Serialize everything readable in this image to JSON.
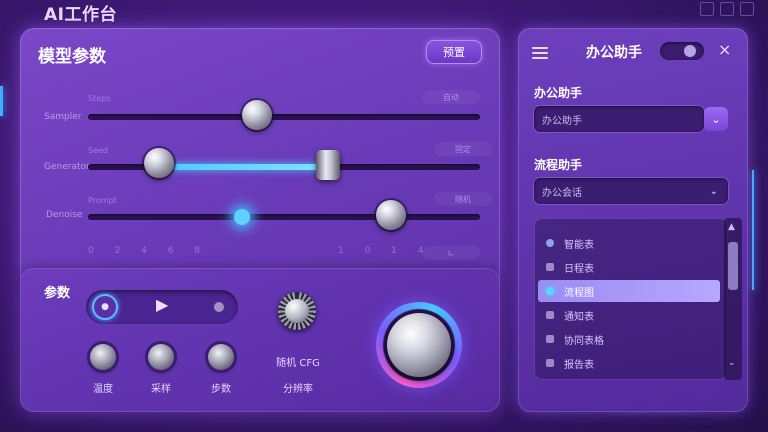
{
  "app": {
    "title": "AI工作台"
  },
  "main": {
    "title": "模型参数",
    "preset_label": "预置",
    "sliders": [
      {
        "label": "Sampler",
        "sub": "Steps",
        "pill": "自动",
        "value": 0.4
      },
      {
        "label": "Generator",
        "sub": "Seed",
        "pill": "固定",
        "range": [
          0.14,
          0.62
        ]
      },
      {
        "label": "Denoise",
        "sub": "Prompt",
        "pill": "随机",
        "value": 0.76,
        "glow": 0.3
      }
    ],
    "tick_left": "0 2 4 6 8",
    "tick_right": "1 0 1 4",
    "end_btn": "∟"
  },
  "params": {
    "title": "参数",
    "play_icon": "▶",
    "knobs": [
      {
        "label": "温度"
      },
      {
        "label": "采样"
      },
      {
        "label": "步数"
      }
    ],
    "ribbed_label": "随机 CFG",
    "ribbed_sub": "分辨率"
  },
  "side": {
    "title": "办公助手",
    "close": "×",
    "field1_label": "办公助手",
    "field1_value": "办公助手",
    "field2_label": "流程助手",
    "field2_value": "办公会话",
    "list": [
      {
        "label": "智能表",
        "style": "round"
      },
      {
        "label": "日程表",
        "style": "square"
      },
      {
        "label": "流程图",
        "style": "selected"
      },
      {
        "label": "通知表",
        "style": "square"
      },
      {
        "label": "协同表格",
        "style": "square"
      },
      {
        "label": "报告表",
        "style": "square"
      }
    ],
    "scroll_up": "▲",
    "scroll_down": "⌄"
  },
  "colors": {
    "accent": "#4ec9ff",
    "panel": "#6a3bb8",
    "background": "#3a1870",
    "selection": "#9a8cf2"
  }
}
